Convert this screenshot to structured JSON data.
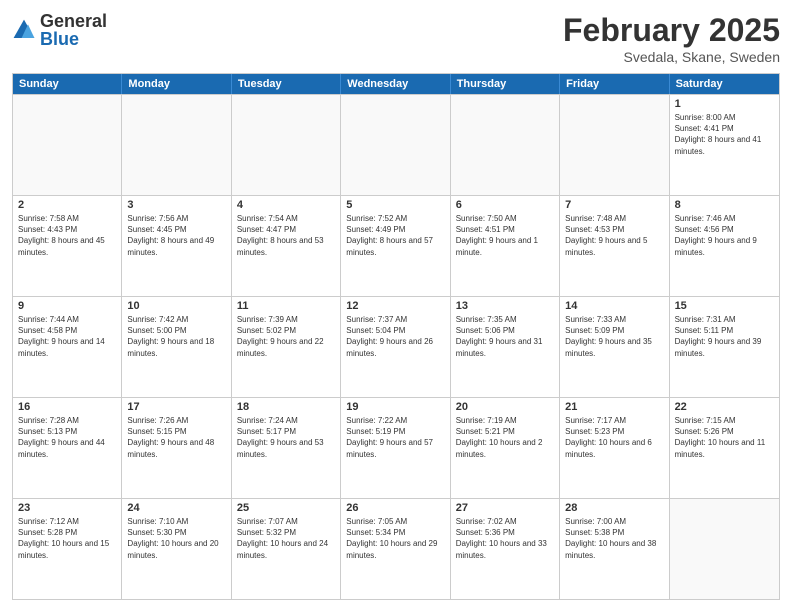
{
  "header": {
    "logo": {
      "general": "General",
      "blue": "Blue"
    },
    "title": "February 2025",
    "location": "Svedala, Skane, Sweden"
  },
  "weekdays": [
    "Sunday",
    "Monday",
    "Tuesday",
    "Wednesday",
    "Thursday",
    "Friday",
    "Saturday"
  ],
  "weeks": [
    [
      {
        "day": "",
        "info": ""
      },
      {
        "day": "",
        "info": ""
      },
      {
        "day": "",
        "info": ""
      },
      {
        "day": "",
        "info": ""
      },
      {
        "day": "",
        "info": ""
      },
      {
        "day": "",
        "info": ""
      },
      {
        "day": "1",
        "info": "Sunrise: 8:00 AM\nSunset: 4:41 PM\nDaylight: 8 hours and 41 minutes."
      }
    ],
    [
      {
        "day": "2",
        "info": "Sunrise: 7:58 AM\nSunset: 4:43 PM\nDaylight: 8 hours and 45 minutes."
      },
      {
        "day": "3",
        "info": "Sunrise: 7:56 AM\nSunset: 4:45 PM\nDaylight: 8 hours and 49 minutes."
      },
      {
        "day": "4",
        "info": "Sunrise: 7:54 AM\nSunset: 4:47 PM\nDaylight: 8 hours and 53 minutes."
      },
      {
        "day": "5",
        "info": "Sunrise: 7:52 AM\nSunset: 4:49 PM\nDaylight: 8 hours and 57 minutes."
      },
      {
        "day": "6",
        "info": "Sunrise: 7:50 AM\nSunset: 4:51 PM\nDaylight: 9 hours and 1 minute."
      },
      {
        "day": "7",
        "info": "Sunrise: 7:48 AM\nSunset: 4:53 PM\nDaylight: 9 hours and 5 minutes."
      },
      {
        "day": "8",
        "info": "Sunrise: 7:46 AM\nSunset: 4:56 PM\nDaylight: 9 hours and 9 minutes."
      }
    ],
    [
      {
        "day": "9",
        "info": "Sunrise: 7:44 AM\nSunset: 4:58 PM\nDaylight: 9 hours and 14 minutes."
      },
      {
        "day": "10",
        "info": "Sunrise: 7:42 AM\nSunset: 5:00 PM\nDaylight: 9 hours and 18 minutes."
      },
      {
        "day": "11",
        "info": "Sunrise: 7:39 AM\nSunset: 5:02 PM\nDaylight: 9 hours and 22 minutes."
      },
      {
        "day": "12",
        "info": "Sunrise: 7:37 AM\nSunset: 5:04 PM\nDaylight: 9 hours and 26 minutes."
      },
      {
        "day": "13",
        "info": "Sunrise: 7:35 AM\nSunset: 5:06 PM\nDaylight: 9 hours and 31 minutes."
      },
      {
        "day": "14",
        "info": "Sunrise: 7:33 AM\nSunset: 5:09 PM\nDaylight: 9 hours and 35 minutes."
      },
      {
        "day": "15",
        "info": "Sunrise: 7:31 AM\nSunset: 5:11 PM\nDaylight: 9 hours and 39 minutes."
      }
    ],
    [
      {
        "day": "16",
        "info": "Sunrise: 7:28 AM\nSunset: 5:13 PM\nDaylight: 9 hours and 44 minutes."
      },
      {
        "day": "17",
        "info": "Sunrise: 7:26 AM\nSunset: 5:15 PM\nDaylight: 9 hours and 48 minutes."
      },
      {
        "day": "18",
        "info": "Sunrise: 7:24 AM\nSunset: 5:17 PM\nDaylight: 9 hours and 53 minutes."
      },
      {
        "day": "19",
        "info": "Sunrise: 7:22 AM\nSunset: 5:19 PM\nDaylight: 9 hours and 57 minutes."
      },
      {
        "day": "20",
        "info": "Sunrise: 7:19 AM\nSunset: 5:21 PM\nDaylight: 10 hours and 2 minutes."
      },
      {
        "day": "21",
        "info": "Sunrise: 7:17 AM\nSunset: 5:23 PM\nDaylight: 10 hours and 6 minutes."
      },
      {
        "day": "22",
        "info": "Sunrise: 7:15 AM\nSunset: 5:26 PM\nDaylight: 10 hours and 11 minutes."
      }
    ],
    [
      {
        "day": "23",
        "info": "Sunrise: 7:12 AM\nSunset: 5:28 PM\nDaylight: 10 hours and 15 minutes."
      },
      {
        "day": "24",
        "info": "Sunrise: 7:10 AM\nSunset: 5:30 PM\nDaylight: 10 hours and 20 minutes."
      },
      {
        "day": "25",
        "info": "Sunrise: 7:07 AM\nSunset: 5:32 PM\nDaylight: 10 hours and 24 minutes."
      },
      {
        "day": "26",
        "info": "Sunrise: 7:05 AM\nSunset: 5:34 PM\nDaylight: 10 hours and 29 minutes."
      },
      {
        "day": "27",
        "info": "Sunrise: 7:02 AM\nSunset: 5:36 PM\nDaylight: 10 hours and 33 minutes."
      },
      {
        "day": "28",
        "info": "Sunrise: 7:00 AM\nSunset: 5:38 PM\nDaylight: 10 hours and 38 minutes."
      },
      {
        "day": "",
        "info": ""
      }
    ]
  ]
}
